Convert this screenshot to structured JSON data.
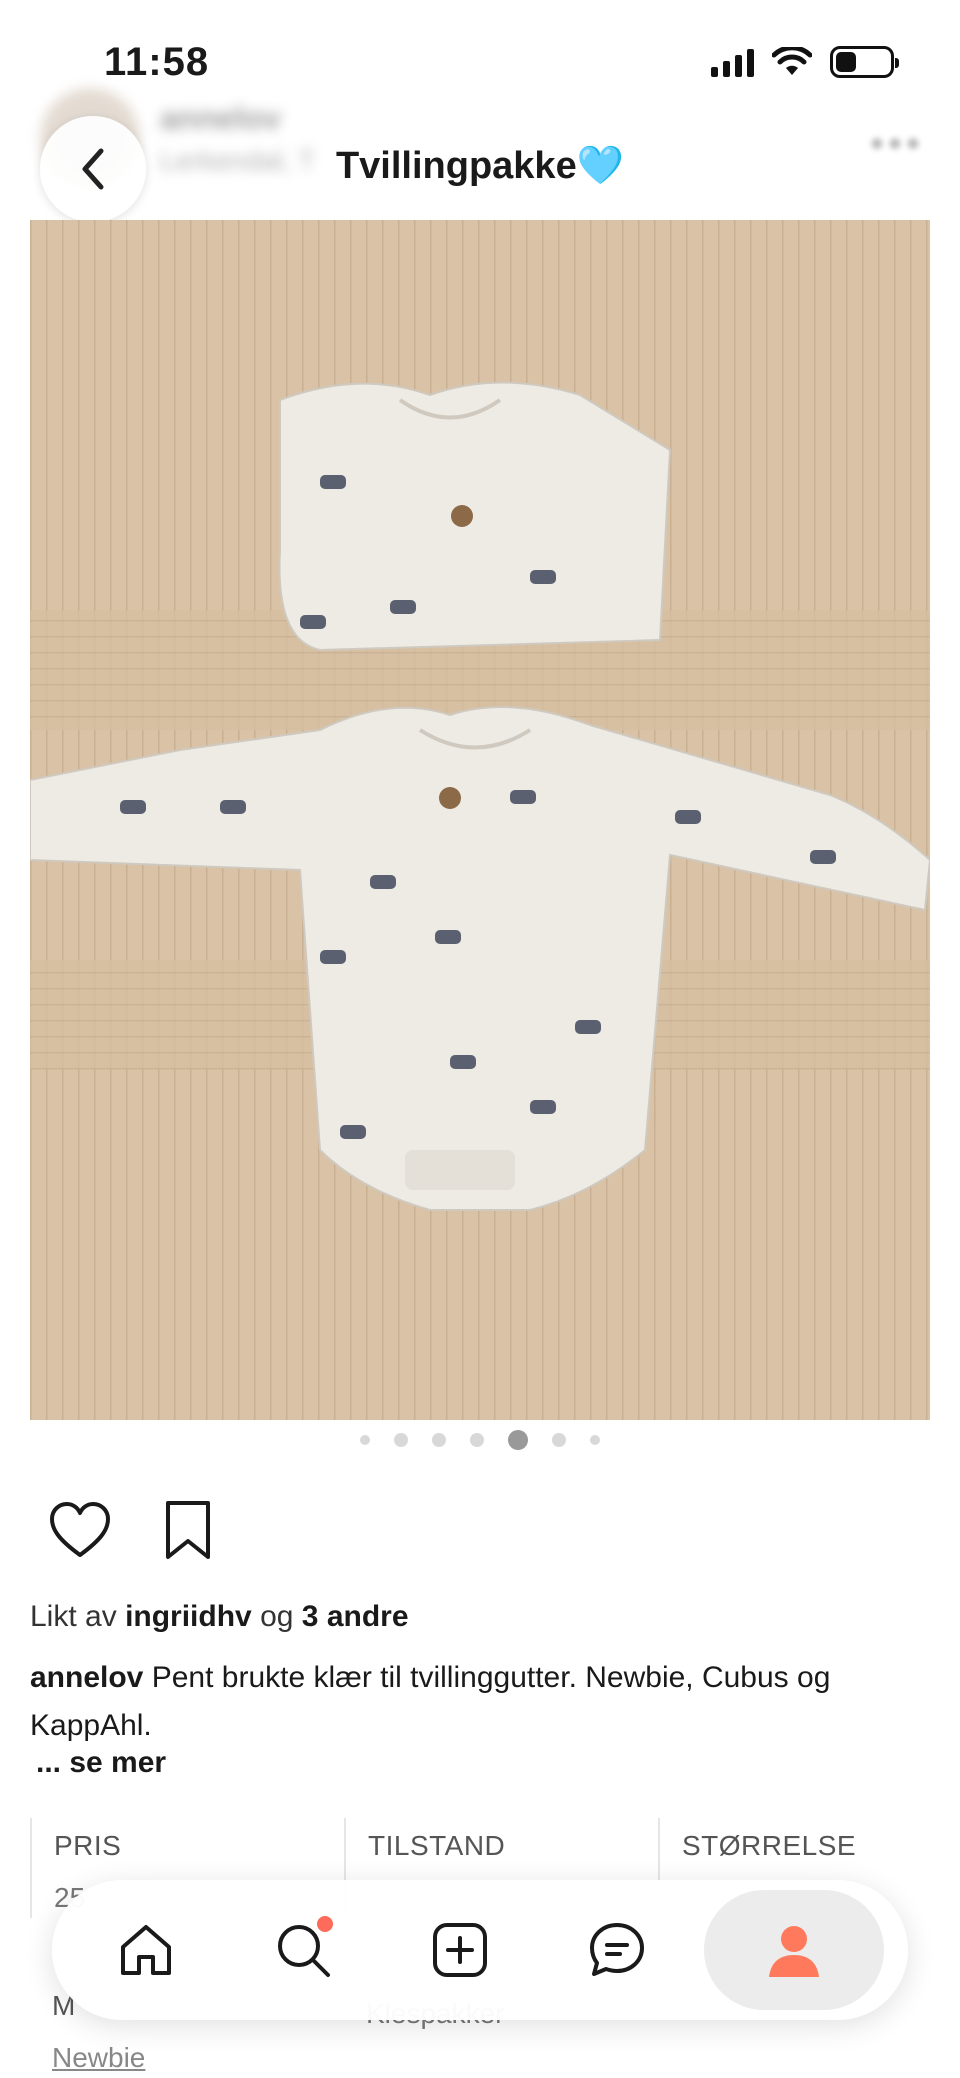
{
  "status_bar": {
    "time": "11:58",
    "icons": [
      "signal-icon",
      "wifi-icon",
      "battery-icon"
    ]
  },
  "seller": {
    "username": "annelov",
    "location": "Lerkendal, T"
  },
  "header": {
    "title": "Tvillingpakke",
    "title_emoji": "🩵",
    "back_icon": "chevron-left-icon",
    "more_icon": "more-dots-icon"
  },
  "photo": {
    "description": "two baby onesies",
    "carousel_count": 7,
    "active_index": 4
  },
  "actions": {
    "like_icon": "heart-icon",
    "save_icon": "bookmark-icon"
  },
  "likes": {
    "prefix": "Likt av",
    "user": "ingriidhv",
    "middle": "og",
    "others": "3 andre"
  },
  "caption": {
    "user": "annelov",
    "text": "Pent brukte klær til tvillinggutter. Newbie, Cubus og KappAhl.",
    "see_more": "... se mer"
  },
  "details": {
    "price": {
      "label": "PRIS",
      "value": "25"
    },
    "condition": {
      "label": "TILSTAND",
      "value": ""
    },
    "size": {
      "label": "STØRRELSE",
      "value": ""
    },
    "brand": {
      "label": "M",
      "value": "Newbie"
    },
    "category": {
      "label": "",
      "value": "Klespakker"
    }
  },
  "nav": {
    "items": [
      "home-icon",
      "search-icon",
      "add-icon",
      "chat-icon",
      "profile-icon"
    ],
    "active": "profile-icon",
    "accent": "#ff7a5c"
  },
  "colors": {
    "accent": "#ff7a5c",
    "heart_emoji": "#6ec4ef"
  }
}
